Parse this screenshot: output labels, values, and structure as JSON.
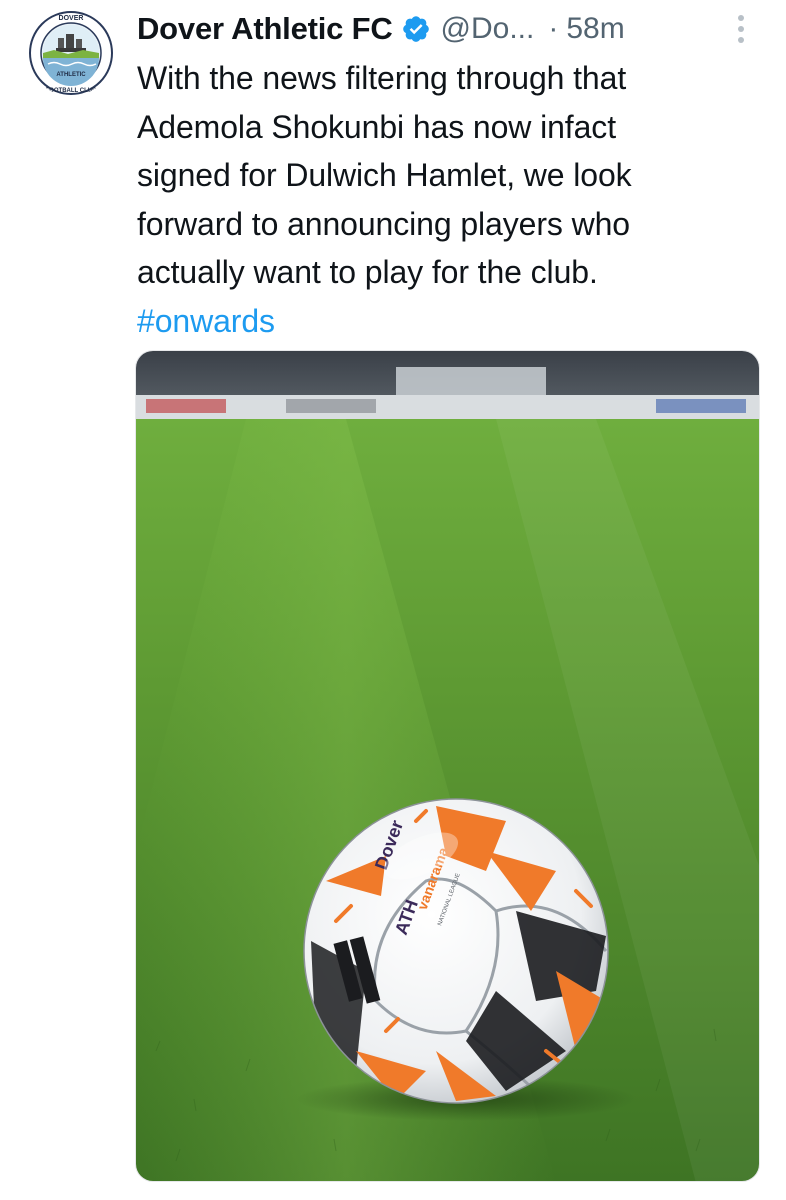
{
  "tweet": {
    "author": {
      "display_name": "Dover Athletic FC",
      "handle": "@Do...",
      "verified": true,
      "avatar_icon": "club-crest-icon",
      "avatar_text_top": "DOVER",
      "avatar_text_side": "ATHLETIC",
      "avatar_text_bottom": "FOOTBALL CLUB"
    },
    "separator": "·",
    "time": "58m",
    "more_icon": "more-vertical-icon",
    "text_lines": [
      "With the news filtering through that",
      "Ademola Shokunbi has now infact",
      "signed for Dulwich Hamlet, we look",
      "forward to announcing players who",
      "actually want to play for the club."
    ],
    "hashtag": "#onwards",
    "media": {
      "description_icon": "football-photo",
      "ball_text_1": "Dover",
      "ball_text_2": "ATH",
      "ball_brand": "vanarama",
      "ball_league": "NATIONAL LEAGUE"
    }
  },
  "colors": {
    "text": "#0f1419",
    "secondary": "#536471",
    "link": "#1d9bf0",
    "verified": "#1d9bf0",
    "grass_light": "#5f9e3a",
    "grass_dark": "#3f7a25",
    "ball_orange": "#f07a2a"
  }
}
